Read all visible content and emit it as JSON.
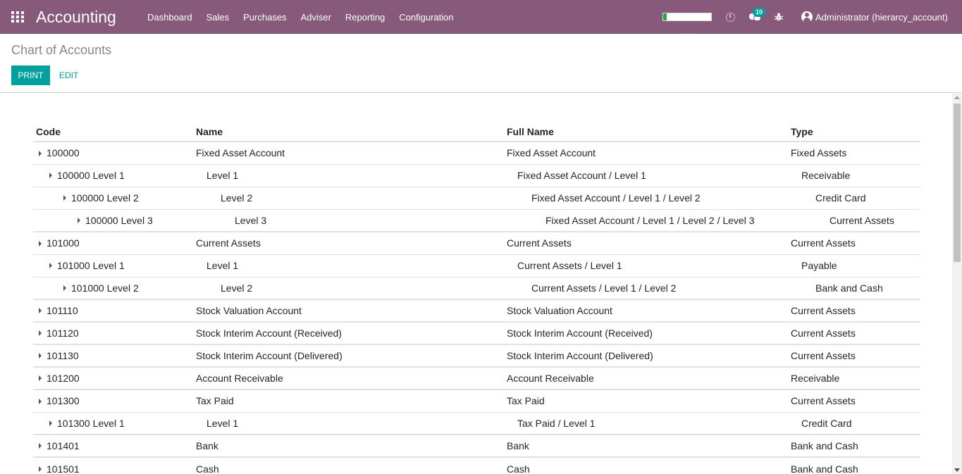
{
  "navbar": {
    "app_title": "Accounting",
    "menu": [
      "Dashboard",
      "Sales",
      "Purchases",
      "Adviser",
      "Reporting",
      "Configuration"
    ],
    "progress": 0.08,
    "messages_badge": "10",
    "user": "Administrator (hierarcy_account)",
    "colors": {
      "bar": "#875A7B",
      "accent": "#00A09D"
    }
  },
  "control_panel": {
    "title": "Chart of Accounts",
    "print_label": "PRINT",
    "edit_label": "EDIT"
  },
  "table": {
    "headers": [
      "Code",
      "Name",
      "Full Name",
      "Type"
    ],
    "rows": [
      {
        "level": 0,
        "code": "100000",
        "name": "Fixed Asset Account",
        "full_name": "Fixed Asset Account",
        "type": "Fixed Assets"
      },
      {
        "level": 1,
        "code": "100000 Level 1",
        "name": "Level 1",
        "full_name": "Fixed Asset Account / Level 1",
        "type": "Receivable"
      },
      {
        "level": 2,
        "code": "100000 Level 2",
        "name": "Level 2",
        "full_name": "Fixed Asset Account / Level 1 / Level 2",
        "type": "Credit Card"
      },
      {
        "level": 3,
        "code": "100000 Level 3",
        "name": "Level 3",
        "full_name": "Fixed Asset Account / Level 1 / Level 2 / Level 3",
        "type": "Current Assets"
      },
      {
        "level": 0,
        "code": "101000",
        "name": "Current Assets",
        "full_name": "Current Assets",
        "type": "Current Assets"
      },
      {
        "level": 1,
        "code": "101000 Level 1",
        "name": "Level 1",
        "full_name": "Current Assets / Level 1",
        "type": "Payable"
      },
      {
        "level": 2,
        "code": "101000 Level 2",
        "name": "Level 2",
        "full_name": "Current Assets / Level 1 / Level 2",
        "type": "Bank and Cash"
      },
      {
        "level": 0,
        "code": "101110",
        "name": "Stock Valuation Account",
        "full_name": "Stock Valuation Account",
        "type": "Current Assets"
      },
      {
        "level": 0,
        "code": "101120",
        "name": "Stock Interim Account (Received)",
        "full_name": "Stock Interim Account (Received)",
        "type": "Current Assets"
      },
      {
        "level": 0,
        "code": "101130",
        "name": "Stock Interim Account (Delivered)",
        "full_name": "Stock Interim Account (Delivered)",
        "type": "Current Assets"
      },
      {
        "level": 0,
        "code": "101200",
        "name": "Account Receivable",
        "full_name": "Account Receivable",
        "type": "Receivable"
      },
      {
        "level": 0,
        "code": "101300",
        "name": "Tax Paid",
        "full_name": "Tax Paid",
        "type": "Current Assets"
      },
      {
        "level": 1,
        "code": "101300 Level 1",
        "name": "Level 1",
        "full_name": "Tax Paid / Level 1",
        "type": "Credit Card"
      },
      {
        "level": 0,
        "code": "101401",
        "name": "Bank",
        "full_name": "Bank",
        "type": "Bank and Cash"
      },
      {
        "level": 0,
        "code": "101501",
        "name": "Cash",
        "full_name": "Cash",
        "type": "Bank and Cash"
      }
    ]
  }
}
